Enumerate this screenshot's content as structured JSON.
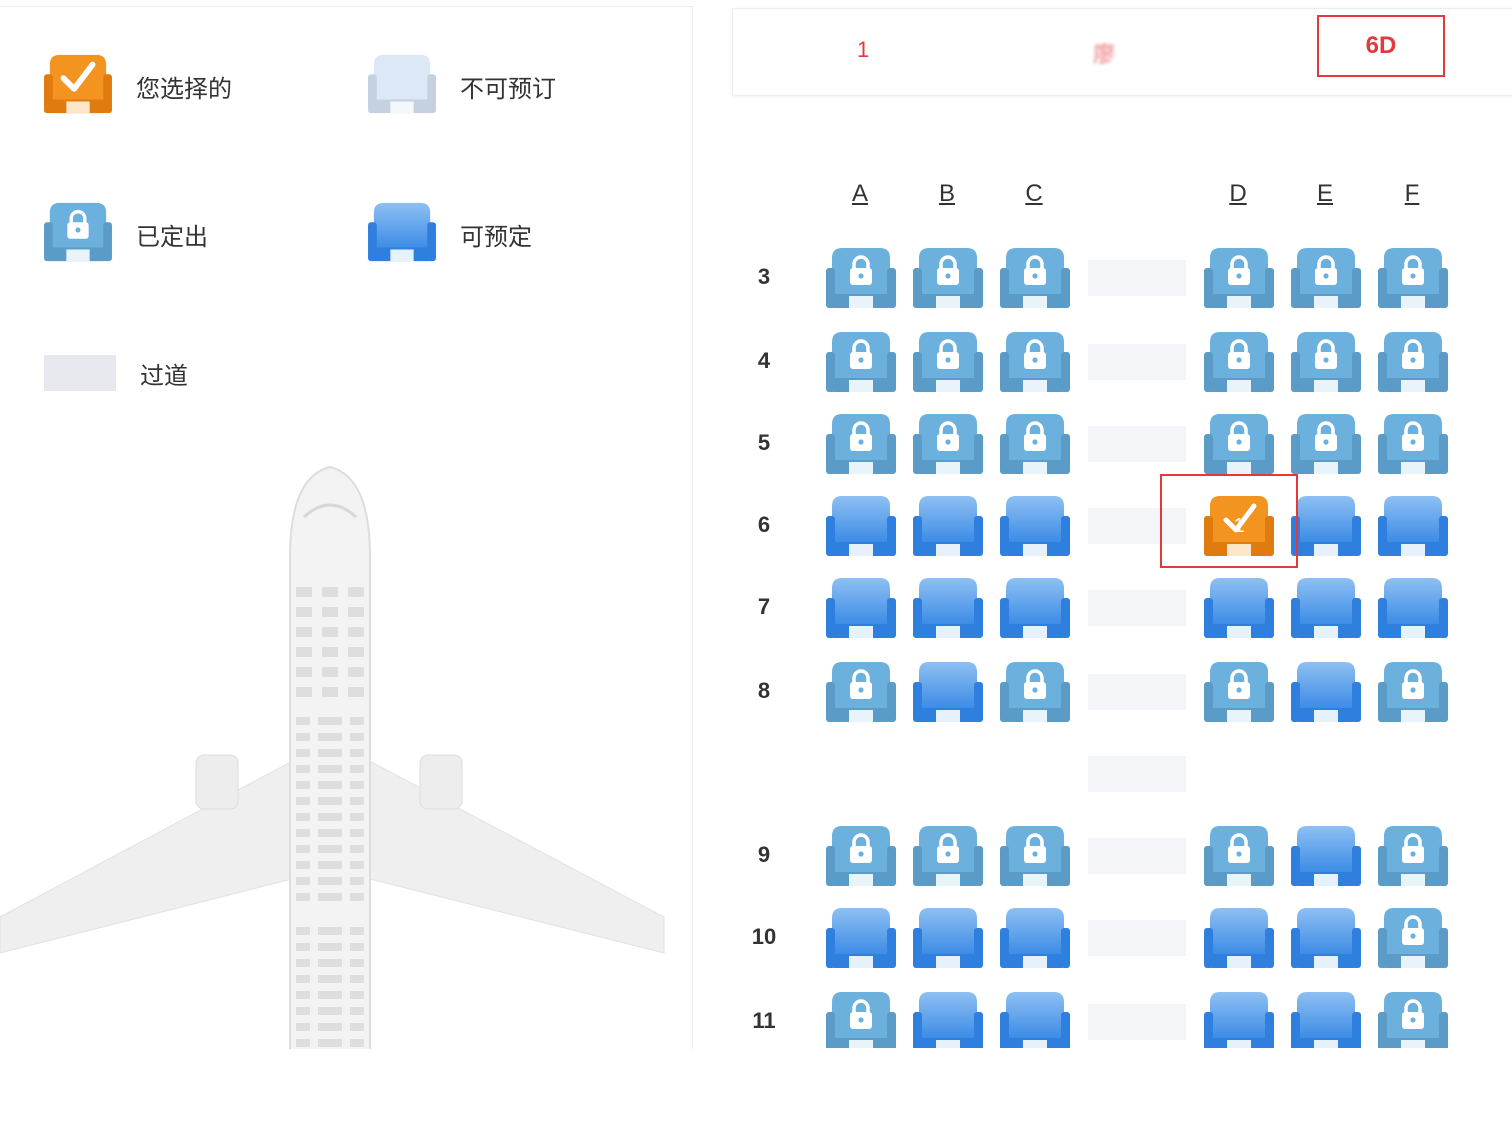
{
  "legend": {
    "selected": "您选择的",
    "unavailable": "不可预订",
    "sold": "已定出",
    "available": "可预定",
    "aisle": "过道"
  },
  "passenger": {
    "index": "1",
    "name": "廖",
    "seat": "6D"
  },
  "seat_map": {
    "columns_left": [
      "A",
      "B",
      "C"
    ],
    "columns_right": [
      "D",
      "E",
      "F"
    ],
    "rows": [
      {
        "label": "3",
        "seats": [
          "sold",
          "sold",
          "sold",
          "sold",
          "sold",
          "sold"
        ]
      },
      {
        "label": "4",
        "seats": [
          "sold",
          "sold",
          "sold",
          "sold",
          "sold",
          "sold"
        ]
      },
      {
        "label": "5",
        "seats": [
          "sold",
          "sold",
          "sold",
          "sold",
          "sold",
          "sold"
        ]
      },
      {
        "label": "6",
        "seats": [
          "available",
          "available",
          "available",
          "selected",
          "available",
          "available"
        ]
      },
      {
        "label": "7",
        "seats": [
          "available",
          "available",
          "available",
          "available",
          "available",
          "available"
        ]
      },
      {
        "label": "8",
        "seats": [
          "sold",
          "available",
          "sold",
          "sold",
          "available",
          "sold"
        ]
      },
      {
        "label": "",
        "seats": []
      },
      {
        "label": "9",
        "seats": [
          "sold",
          "sold",
          "sold",
          "sold",
          "available",
          "sold"
        ]
      },
      {
        "label": "10",
        "seats": [
          "available",
          "available",
          "available",
          "available",
          "available",
          "sold"
        ]
      },
      {
        "label": "11",
        "seats": [
          "sold",
          "available",
          "available",
          "available",
          "available",
          "sold"
        ]
      }
    ],
    "selected_seat_marker": "1"
  },
  "colors": {
    "accent_red": "#e4393c",
    "selected_orange": "#f39320",
    "sold_blue": "#6cb1dd",
    "available_blue": "#3b8be8",
    "unavailable": "#dce7f5",
    "aisle": "#e7e9ee"
  }
}
